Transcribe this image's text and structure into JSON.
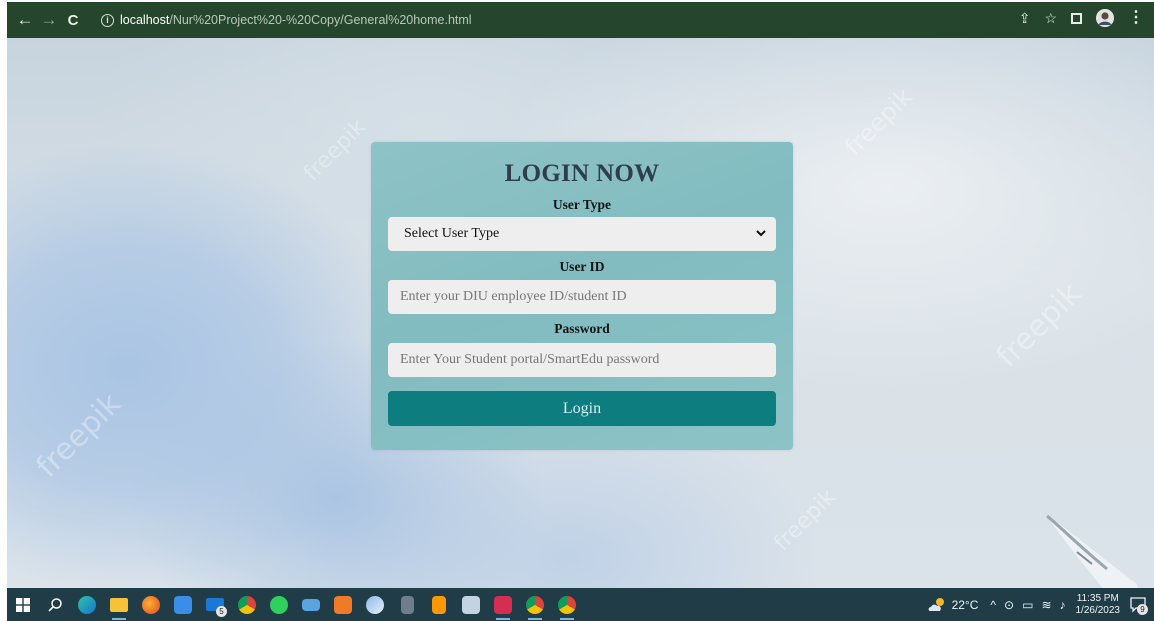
{
  "browser": {
    "url_host": "localhost",
    "url_path": "/Nur%20Project%20-%20Copy/General%20home.html",
    "back_icon": "←",
    "forward_icon": "→",
    "reload_icon": "C",
    "info_icon": "i",
    "share_icon": "⇪",
    "star_icon": "☆",
    "menu_icon": "⋮"
  },
  "login": {
    "title": "LOGIN NOW",
    "user_type_label": "User Type",
    "user_type_selected": "Select User Type",
    "user_id_label": "User ID",
    "user_id_placeholder": "Enter your DIU employee ID/student ID",
    "password_label": "Password",
    "password_placeholder": "Enter Your Student portal/SmartEdu password",
    "button_label": "Login",
    "button_color": "#0e7d7f",
    "card_color": "#8ec3c6"
  },
  "watermark": {
    "text": "freepik"
  },
  "taskbar": {
    "badge_mail": "5",
    "temperature": "22°C",
    "time": "11:35 PM",
    "date": "1/26/2023",
    "notification_count": "9",
    "color": "#1f3c47"
  }
}
